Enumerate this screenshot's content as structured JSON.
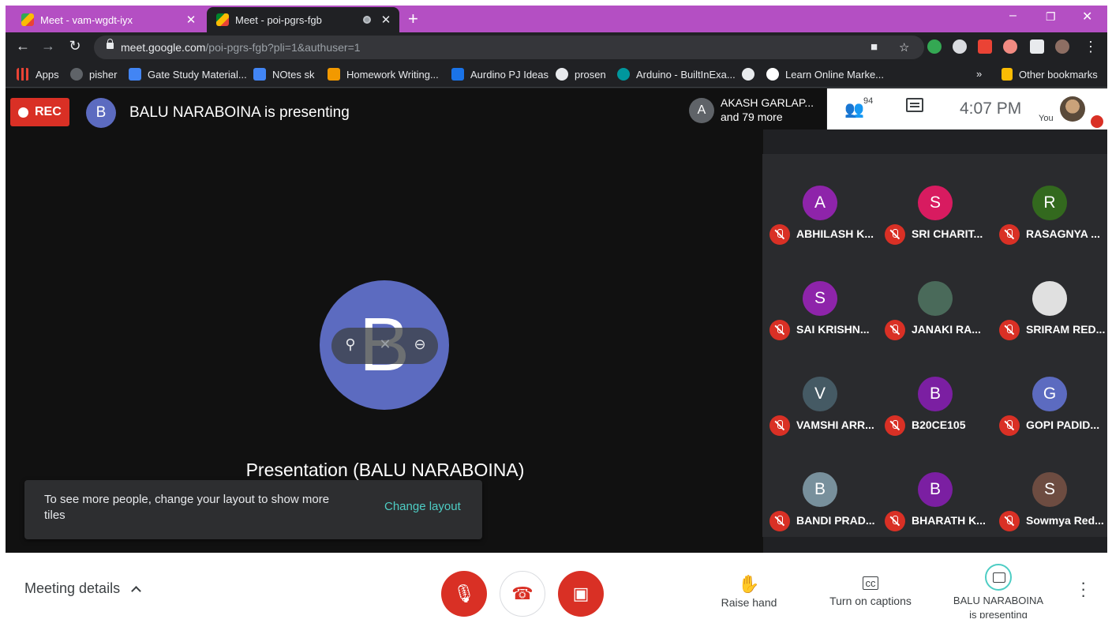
{
  "browser": {
    "tabs": [
      {
        "title": "Meet - vam-wgdt-iyx",
        "close": "✕"
      },
      {
        "title": "Meet - poi-pgrs-fgb",
        "close": "✕"
      }
    ],
    "new_tab": "+",
    "window_controls": {
      "minimize": "–",
      "restore": "❐",
      "close": "✕"
    },
    "url_domain": "meet.google.com",
    "url_path": "/poi-pgrs-fgb?pli=1&authuser=1",
    "bookmarks": [
      {
        "label": "Apps",
        "icon": "apps-grid-icon",
        "color": "#ea4335"
      },
      {
        "label": "pisher",
        "icon": "github-icon",
        "color": "#5f6368"
      },
      {
        "label": "Gate Study Material...",
        "icon": "doc-icon",
        "color": "#4285f4"
      },
      {
        "label": "NOtes sk",
        "icon": "doc-icon",
        "color": "#4285f4"
      },
      {
        "label": "Homework Writing...",
        "icon": "homework-icon",
        "color": "#f29900"
      },
      {
        "label": "Aurdino PJ Ideas",
        "icon": "e-icon",
        "color": "#1a73e8"
      },
      {
        "label": "prosen",
        "icon": "globe-icon",
        "color": "#e8eaed"
      },
      {
        "label": "Arduino - BuiltInExa...",
        "icon": "arduino-icon",
        "color": "#00979d"
      },
      {
        "label": "",
        "icon": "globe-icon",
        "color": "#e8eaed"
      },
      {
        "label": "Learn Online Marke...",
        "icon": "google-icon",
        "color": "#ffffff"
      }
    ],
    "bookmarks_more": "»",
    "other_bookmarks": "Other bookmarks"
  },
  "meet": {
    "rec_label": "REC",
    "presenter_initial": "B",
    "presenting_text": "BALU NARABOINA is presenting",
    "stage_avatar_initial": "B",
    "stage_label": "Presentation (BALU NARABOINA)",
    "toast": {
      "message": "To see more people, change your layout to show more tiles",
      "action": "Change layout"
    },
    "top_participant": {
      "initial": "A",
      "name": "AKASH GARLAP...",
      "more": "and 79 more"
    },
    "people_count": "94",
    "time": "4:07 PM",
    "you_label": "You",
    "participants": [
      {
        "initial": "A",
        "name": "ABHILASH K...",
        "color": "#8e24aa"
      },
      {
        "initial": "S",
        "name": "SRI CHARIT...",
        "color": "#d81b60"
      },
      {
        "initial": "R",
        "name": "RASAGNYA ...",
        "color": "#33691e"
      },
      {
        "initial": "S",
        "name": "SAI KRISHN...",
        "color": "#8e24aa"
      },
      {
        "initial": "",
        "name": "JANAKI RA...",
        "color": "#4a6a5a"
      },
      {
        "initial": "",
        "name": "SRIRAM RED...",
        "color": "#e0e0e0"
      },
      {
        "initial": "V",
        "name": "VAMSHI ARR...",
        "color": "#455a64"
      },
      {
        "initial": "B",
        "name": "B20CE105",
        "color": "#7b1fa2"
      },
      {
        "initial": "G",
        "name": "GOPI PADID...",
        "color": "#5c6bc0"
      },
      {
        "initial": "B",
        "name": "BANDI PRAD...",
        "color": "#78909c"
      },
      {
        "initial": "B",
        "name": "BHARATH K...",
        "color": "#7b1fa2"
      },
      {
        "initial": "S",
        "name": "Sowmya Red...",
        "color": "#6d4c41"
      }
    ],
    "bottom": {
      "details_label": "Meeting details",
      "raise_hand": "Raise hand",
      "captions": "Turn on captions",
      "present_line1": "BALU NARABOINA",
      "present_line2": "is presenting"
    },
    "colors": {
      "accent": "#4ecdc4",
      "danger": "#d93025",
      "presenter": "#5c6bc0"
    }
  }
}
